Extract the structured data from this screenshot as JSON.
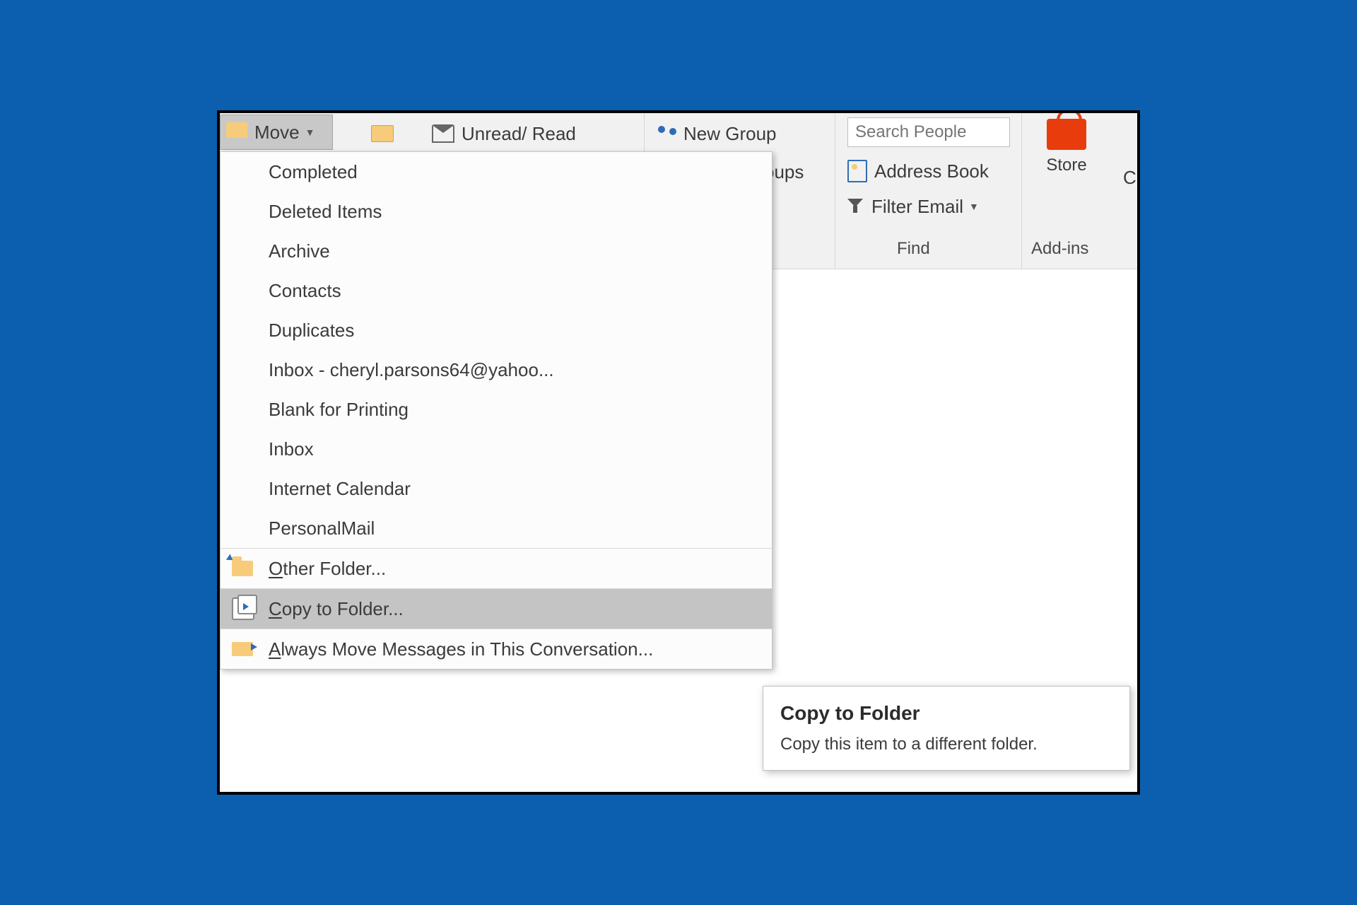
{
  "ribbon": {
    "move_label": "Move",
    "unread_label": "Unread/ Read",
    "newgroup_label": "New Group",
    "groups_partial": "oups",
    "search_placeholder": "Search People",
    "addressbook_label": "Address Book",
    "filter_label": "Filter Email",
    "find_group": "Find",
    "store_label": "Store",
    "addins_group": "Add-ins",
    "edge_letter": "C"
  },
  "menu": {
    "items": [
      {
        "label": "Completed"
      },
      {
        "label": "Deleted Items"
      },
      {
        "label": "Archive"
      },
      {
        "label": "Contacts"
      },
      {
        "label": "Duplicates"
      },
      {
        "label": "Inbox - cheryl.parsons64@yahoo..."
      },
      {
        "label": "Blank for Printing"
      },
      {
        "label": "Inbox"
      },
      {
        "label": "Internet Calendar"
      },
      {
        "label": "PersonalMail"
      }
    ],
    "other_folder": "Other Folder...",
    "copy_to_folder": "Copy to Folder...",
    "always_move": "Always Move Messages in This Conversation..."
  },
  "tooltip": {
    "title": "Copy to Folder",
    "body": "Copy this item to a different folder."
  }
}
